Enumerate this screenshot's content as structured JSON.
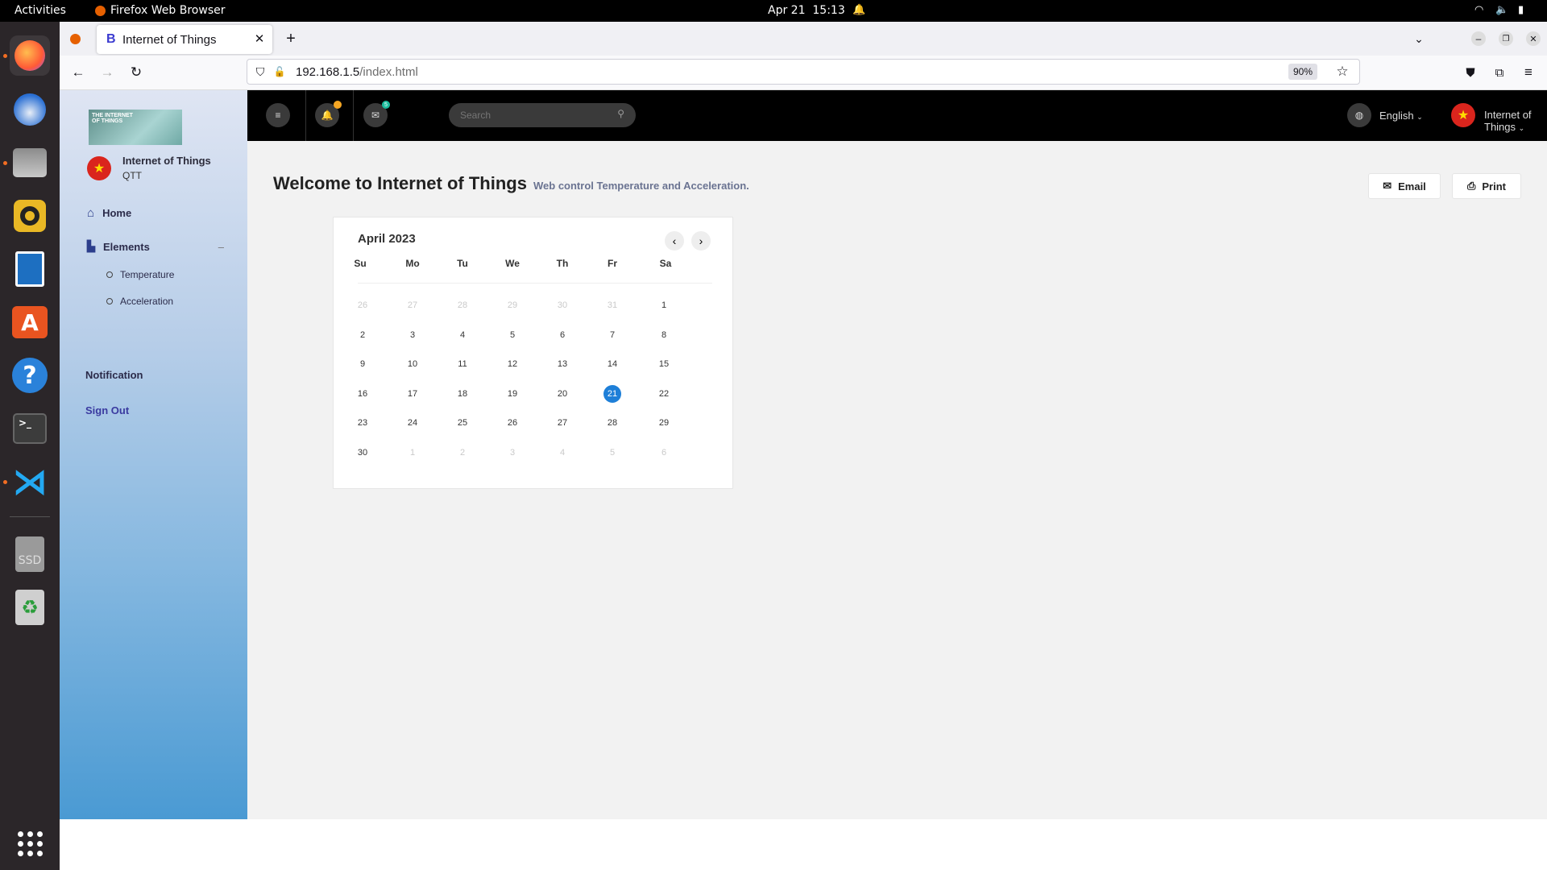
{
  "system": {
    "activities": "Activities",
    "app_name": "Firefox Web Browser",
    "date": "Apr 21",
    "time": "15:13"
  },
  "browser": {
    "tab_title": "Internet of Things",
    "tab_favicon": "B",
    "url_host": "192.168.1.5",
    "url_path": "/index.html",
    "zoom": "90%"
  },
  "sidebar": {
    "brand_logo_text": "THE INTERNET OF THINGS",
    "profile_name": "Internet of Things",
    "profile_sub": "QTT",
    "home_label": "Home",
    "elements_label": "Elements",
    "sub_items": [
      "Temperature",
      "Acceleration"
    ],
    "notification_label": "Notification",
    "signout_label": "Sign Out"
  },
  "appbar": {
    "search_placeholder": "Search",
    "mail_badge": "5",
    "language": "English",
    "user": "Internet of Things"
  },
  "page": {
    "title": "Welcome to Internet of Things",
    "subtitle": "Web control Temperature and Acceleration.",
    "email_btn": "Email",
    "print_btn": "Print"
  },
  "calendar": {
    "month_label": "April 2023",
    "weekdays": [
      "Su",
      "Mo",
      "Tu",
      "We",
      "Th",
      "Fr",
      "Sa"
    ],
    "weeks": [
      [
        "26",
        "27",
        "28",
        "29",
        "30",
        "31",
        "1"
      ],
      [
        "2",
        "3",
        "4",
        "5",
        "6",
        "7",
        "8"
      ],
      [
        "9",
        "10",
        "11",
        "12",
        "13",
        "14",
        "15"
      ],
      [
        "16",
        "17",
        "18",
        "19",
        "20",
        "21",
        "22"
      ],
      [
        "23",
        "24",
        "25",
        "26",
        "27",
        "28",
        "29"
      ],
      [
        "30",
        "1",
        "2",
        "3",
        "4",
        "5",
        "6"
      ]
    ],
    "selected": "21",
    "accent": "#1e7fd8"
  },
  "colors": {
    "appbar": "#000000",
    "flag_red": "#da251d",
    "signout": "#3a3aa0"
  }
}
